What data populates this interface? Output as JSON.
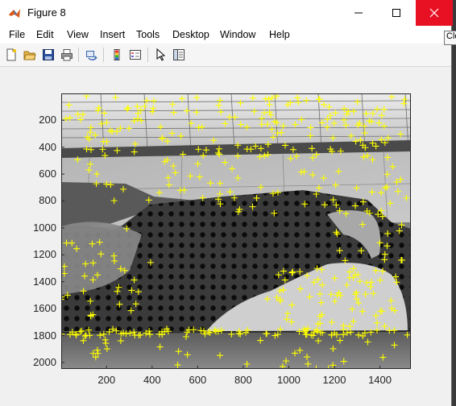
{
  "window": {
    "title": "Figure 8"
  },
  "menubar": {
    "items": [
      "File",
      "Edit",
      "View",
      "Insert",
      "Tools",
      "Desktop",
      "Window",
      "Help"
    ]
  },
  "tooltip": {
    "text": "Close"
  },
  "toolbar": {
    "icons": [
      "new-figure-icon",
      "open-file-icon",
      "save-icon",
      "print-icon",
      "link-plot-icon",
      "insert-colorbar-icon",
      "insert-legend-icon",
      "edit-plot-icon",
      "property-inspector-icon"
    ]
  },
  "chart_data": {
    "type": "scatter",
    "xlim": [
      1,
      1536
    ],
    "ylim": [
      2048,
      1
    ],
    "x_ticks": [
      200,
      400,
      600,
      800,
      1000,
      1200,
      1400
    ],
    "y_ticks": [
      200,
      400,
      600,
      800,
      1000,
      1200,
      1400,
      1600,
      1800,
      2000
    ],
    "x_tick_labels": [
      "200",
      "400",
      "600",
      "800",
      "1000",
      "1200",
      "1400"
    ],
    "y_tick_labels": [
      "200",
      "400",
      "600",
      "800",
      "1000",
      "1200",
      "1400",
      "1600",
      "1800",
      "2000"
    ],
    "marker": "+",
    "marker_color": "#ffff00",
    "clusters": [
      {
        "region": "skylight",
        "x": [
          20,
          1520
        ],
        "y": [
          20,
          420
        ]
      },
      {
        "region": "upper-left-stone",
        "x": [
          60,
          700
        ],
        "y": [
          420,
          800
        ]
      },
      {
        "region": "upper-right-stone",
        "x": [
          600,
          1520
        ],
        "y": [
          400,
          900
        ]
      },
      {
        "region": "right-wall",
        "x": [
          1200,
          1520
        ],
        "y": [
          800,
          1400
        ]
      },
      {
        "region": "left-wall",
        "x": [
          0,
          420
        ],
        "y": [
          1000,
          1700
        ]
      },
      {
        "region": "bright-dome",
        "x": [
          900,
          1500
        ],
        "y": [
          1300,
          1800
        ]
      },
      {
        "region": "floor-line",
        "x": [
          0,
          1530
        ],
        "y": [
          1750,
          1800
        ]
      },
      {
        "region": "floor",
        "x": [
          0,
          1530
        ],
        "y": [
          1800,
          2048
        ]
      }
    ]
  }
}
